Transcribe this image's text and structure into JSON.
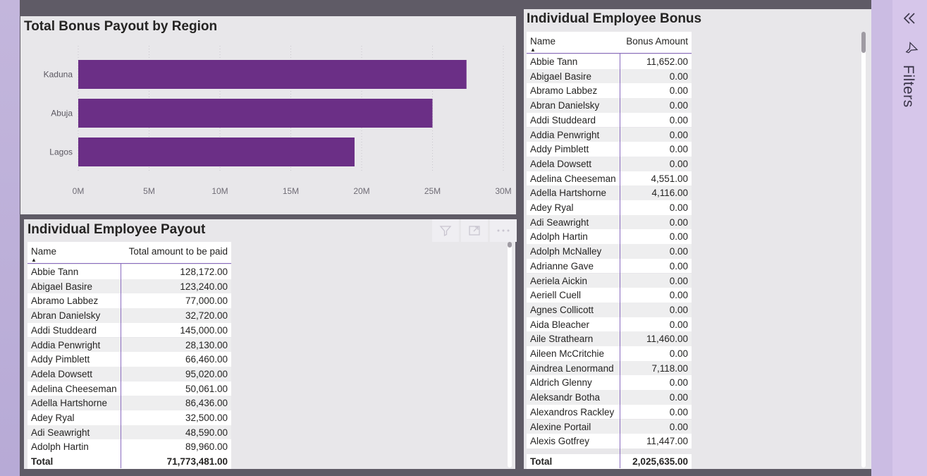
{
  "chart": {
    "title": "Total Bonus Payout by Region"
  },
  "chart_data": {
    "type": "bar",
    "orientation": "horizontal",
    "title": "Total Bonus Payout by Region",
    "categories": [
      "Kaduna",
      "Abuja",
      "Lagos"
    ],
    "values": [
      27.4,
      25.0,
      19.5
    ],
    "value_unit": "M",
    "xlim": [
      0,
      30
    ],
    "xticks": [
      "0M",
      "5M",
      "10M",
      "15M",
      "20M",
      "25M",
      "30M"
    ],
    "color": "#6b2f86",
    "grid": "vertical dotted"
  },
  "payout": {
    "title": "Individual Employee Payout",
    "col_name": "Name",
    "col_value": "Total amount to be paid",
    "rows": [
      [
        "Abbie Tann",
        "128,172.00"
      ],
      [
        "Abigael Basire",
        "123,240.00"
      ],
      [
        "Abramo Labbez",
        "77,000.00"
      ],
      [
        "Abran Danielsky",
        "32,720.00"
      ],
      [
        "Addi Studdeard",
        "145,000.00"
      ],
      [
        "Addia Penwright",
        "28,130.00"
      ],
      [
        "Addy Pimblett",
        "66,460.00"
      ],
      [
        "Adela Dowsett",
        "95,020.00"
      ],
      [
        "Adelina Cheeseman",
        "50,061.00"
      ],
      [
        "Adella Hartshorne",
        "86,436.00"
      ],
      [
        "Adey Ryal",
        "32,500.00"
      ],
      [
        "Adi Seawright",
        "48,590.00"
      ],
      [
        "Adolph Hartin",
        "89,960.00"
      ]
    ],
    "total_label": "Total",
    "total_value": "71,773,481.00"
  },
  "bonus": {
    "title": "Individual Employee Bonus",
    "col_name": "Name",
    "col_value": "Bonus Amount",
    "rows": [
      [
        "Abbie Tann",
        "11,652.00"
      ],
      [
        "Abigael Basire",
        "0.00"
      ],
      [
        "Abramo Labbez",
        "0.00"
      ],
      [
        "Abran Danielsky",
        "0.00"
      ],
      [
        "Addi Studdeard",
        "0.00"
      ],
      [
        "Addia Penwright",
        "0.00"
      ],
      [
        "Addy Pimblett",
        "0.00"
      ],
      [
        "Adela Dowsett",
        "0.00"
      ],
      [
        "Adelina Cheeseman",
        "4,551.00"
      ],
      [
        "Adella Hartshorne",
        "4,116.00"
      ],
      [
        "Adey Ryal",
        "0.00"
      ],
      [
        "Adi Seawright",
        "0.00"
      ],
      [
        "Adolph Hartin",
        "0.00"
      ],
      [
        "Adolph McNalley",
        "0.00"
      ],
      [
        "Adrianne Gave",
        "0.00"
      ],
      [
        "Aeriela Aickin",
        "0.00"
      ],
      [
        "Aeriell Cuell",
        "0.00"
      ],
      [
        "Agnes Collicott",
        "0.00"
      ],
      [
        "Aida Bleacher",
        "0.00"
      ],
      [
        "Aile Strathearn",
        "11,460.00"
      ],
      [
        "Aileen McCritchie",
        "0.00"
      ],
      [
        "Aindrea Lenormand",
        "7,118.00"
      ],
      [
        "Aldrich Glenny",
        "0.00"
      ],
      [
        "Aleksandr Botha",
        "0.00"
      ],
      [
        "Alexandros Rackley",
        "0.00"
      ],
      [
        "Alexine Portail",
        "0.00"
      ],
      [
        "Alexis Gotfrey",
        "11,447.00"
      ]
    ],
    "total_label": "Total",
    "total_value": "2,025,635.00"
  },
  "filters": {
    "label": "Filters",
    "collapse_icon": "double-chevron-left-icon",
    "filter_icon": "funnel-icon"
  },
  "visual_header_icons": [
    "funnel-icon",
    "focus-mode-icon",
    "more-options-icon"
  ]
}
